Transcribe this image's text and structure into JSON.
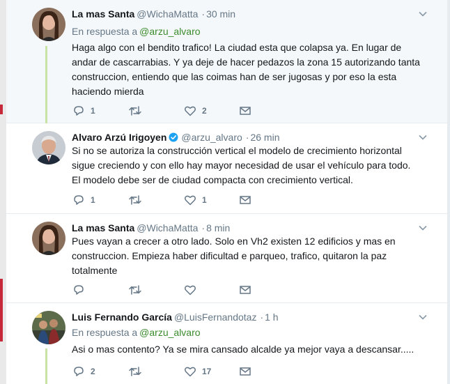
{
  "colors": {
    "link": "#3a8b2c",
    "thread_line": "#c9e3a6",
    "muted": "#657786"
  },
  "tweets": [
    {
      "name": "La mas Santa",
      "handle": "@WichaMatta",
      "separator": "·",
      "time": "30 min",
      "reply_prefix": "En respuesta a",
      "reply_handle": "@arzu_alvaro",
      "lines": [
        "Haga algo con el bendito trafico! La ciudad esta que colapsa ya. En lugar de",
        "andar de cascarrabias. Y ya deje de hacer pedazos la zona 15 autorizando tanta",
        "construccion, entiendo que las coimas han de ser jugosas y por eso la esta",
        "haciendo mierda"
      ],
      "reply_count": "1",
      "retweet_count": "",
      "like_count": "2"
    },
    {
      "name": "Alvaro Arzú Irigoyen",
      "verified_icon": "verified-badge-icon",
      "handle": "@arzu_alvaro",
      "separator": "·",
      "time": "26 min",
      "lines": [
        "Si no se autoriza la construcción vertical el modelo de crecimiento horizontal",
        "sigue creciendo y con ello hay mayor necesidad de usar el vehículo para todo.",
        "El modelo debe ser de ciudad compacta con crecimiento vertical."
      ],
      "reply_count": "1",
      "retweet_count": "",
      "like_count": "1"
    },
    {
      "name": "La mas Santa",
      "handle": "@WichaMatta",
      "separator": "·",
      "time": "8 min",
      "lines": [
        "Pues vayan a crecer a otro lado. Solo en Vh2 existen 12 edificios y mas en",
        "construccion. Empieza haber dificultad e  parqueo, trafico, quitaron la paz",
        "totalmente"
      ],
      "reply_count": "",
      "retweet_count": "",
      "like_count": ""
    },
    {
      "name": "Luis Fernando García",
      "handle": "@LuisFernandotaz",
      "separator": "·",
      "time": "1 h",
      "reply_prefix": "En respuesta a",
      "reply_handle": "@arzu_alvaro",
      "lines": [
        "Asi o mas contento? Ya se mira cansado alcalde ya mejor vaya a descansar....."
      ],
      "reply_count": "2",
      "retweet_count": "",
      "like_count": "17"
    }
  ]
}
